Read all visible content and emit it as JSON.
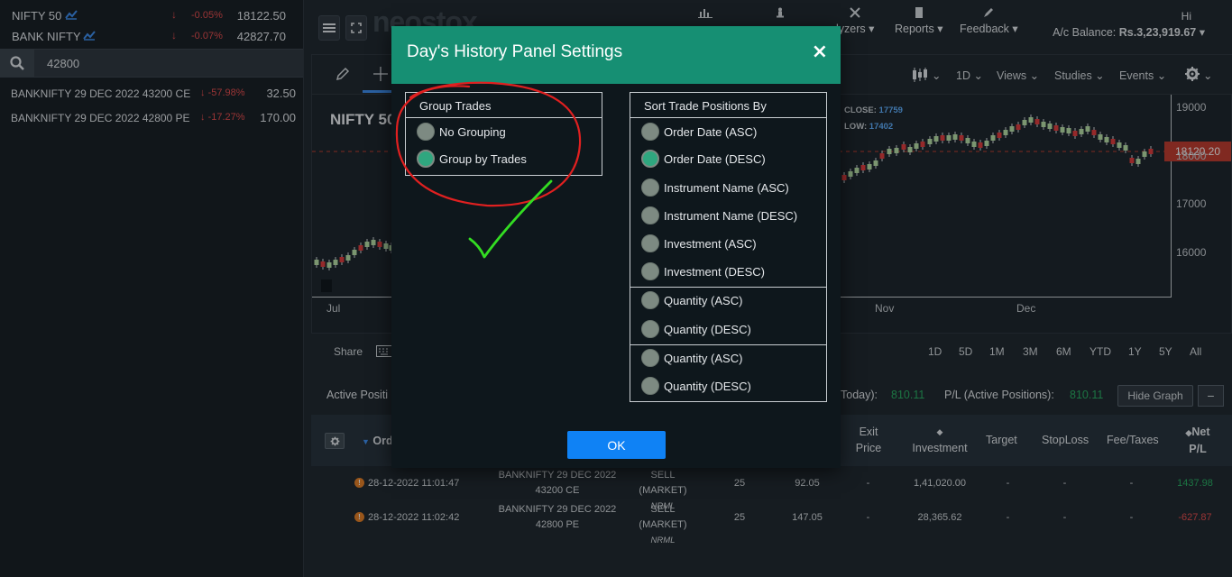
{
  "watchlist": {
    "indices": [
      {
        "name": "NIFTY 50",
        "change": "-0.05%",
        "price": "18122.50"
      },
      {
        "name": "BANK NIFTY",
        "change": "-0.07%",
        "price": "42827.70"
      }
    ],
    "search": {
      "value": "42800"
    },
    "results": [
      {
        "name": "BANKNIFTY 29 DEC 2022 43200 CE",
        "change": "-57.98%",
        "price": "32.50"
      },
      {
        "name": "BANKNIFTY 29 DEC 2022 42800 PE",
        "change": "-17.27%",
        "price": "170.00"
      }
    ]
  },
  "topbar": {
    "logo": "neostox",
    "menus": [
      {
        "label": "lyzers",
        "icon": "analyzers-icon"
      },
      {
        "label": "Reports",
        "icon": "document-icon"
      },
      {
        "label": "Feedback",
        "icon": "pen-icon"
      }
    ],
    "greeting": "Hi",
    "balance_label": "A/c Balance:",
    "balance_value": "Rs.3,23,919.67"
  },
  "chart": {
    "symbol": "NIFTY 50",
    "close_label": "CLOSE:",
    "close_value": "17759",
    "low_label": "LOW:",
    "low_value": "17402",
    "last_price": "18120.20",
    "toolbar": {
      "interval": "1D",
      "views": "Views",
      "studies": "Studies",
      "events": "Events"
    },
    "y_ticks": [
      "19000",
      "18000",
      "17000",
      "16000"
    ],
    "x_ticks": [
      "Jul",
      "Nov",
      "Dec"
    ],
    "ranges": [
      "1D",
      "5D",
      "1M",
      "3M",
      "6M",
      "YTD",
      "1Y",
      "5Y",
      "All"
    ],
    "share_label": "Share"
  },
  "positions": {
    "title": "Active Positi",
    "today_label": "Today):",
    "today_value": "810.11",
    "pl_label": "P/L (Active Positions):",
    "pl_value": "810.11",
    "hide_graph": "Hide Graph",
    "minimize": "−"
  },
  "table": {
    "headers": {
      "order": "Ord",
      "exit_price": "Exit\nPrice",
      "investment": "Investment",
      "target": "Target",
      "stoploss": "StopLoss",
      "fee": "Fee/Taxes",
      "net_pl": "Net\nP/L"
    },
    "rows": [
      {
        "date": "28-12-2022 11:01:47",
        "instrument_l1": "BANKNIFTY 29 DEC 2022",
        "instrument_l2": "43200 CE",
        "side": "SELL (MARKET)",
        "product": "NRML",
        "qty": "25",
        "price": "92.05",
        "exit": "-",
        "investment": "1,41,020.00",
        "target": "-",
        "stoploss": "-",
        "fee": "-",
        "pl": "1437.98",
        "pl_color": "#27ae60"
      },
      {
        "date": "28-12-2022 11:02:42",
        "instrument_l1": "BANKNIFTY 29 DEC 2022",
        "instrument_l2": "42800 PE",
        "side": "SELL (MARKET)",
        "product": "NRML",
        "qty": "25",
        "price": "147.05",
        "exit": "-",
        "investment": "28,365.62",
        "target": "-",
        "stoploss": "-",
        "fee": "-",
        "pl": "-627.87",
        "pl_color": "#e84b4b"
      }
    ]
  },
  "modal": {
    "title": "Day's History Panel Settings",
    "close": "×",
    "group": {
      "title": "Group Trades",
      "options": [
        {
          "label": "No Grouping",
          "selected": false
        },
        {
          "label": "Group by Trades",
          "selected": true
        }
      ]
    },
    "sort": {
      "title": "Sort Trade Positions By",
      "options": [
        {
          "label": "Order Date (ASC)",
          "selected": false
        },
        {
          "label": "Order Date (DESC)",
          "selected": true
        },
        {
          "label": "Instrument Name (ASC)",
          "selected": false
        },
        {
          "label": "Instrument Name (DESC)",
          "selected": false
        },
        {
          "label": "Investment (ASC)",
          "selected": false
        },
        {
          "label": "Investment (DESC)",
          "selected": false
        },
        {
          "label": "Quantity (ASC)",
          "selected": false
        },
        {
          "label": "Quantity (DESC)",
          "selected": false
        },
        {
          "label": "Quantity (ASC)",
          "selected": false
        },
        {
          "label": "Quantity (DESC)",
          "selected": false
        }
      ]
    },
    "ok": "OK"
  },
  "colors": {
    "accent_header": "#168f73",
    "ok_button": "#0f82f5",
    "down": "#e84b4b",
    "up": "#27ae60",
    "annotation": "#e02020",
    "check": "#33dd22"
  }
}
